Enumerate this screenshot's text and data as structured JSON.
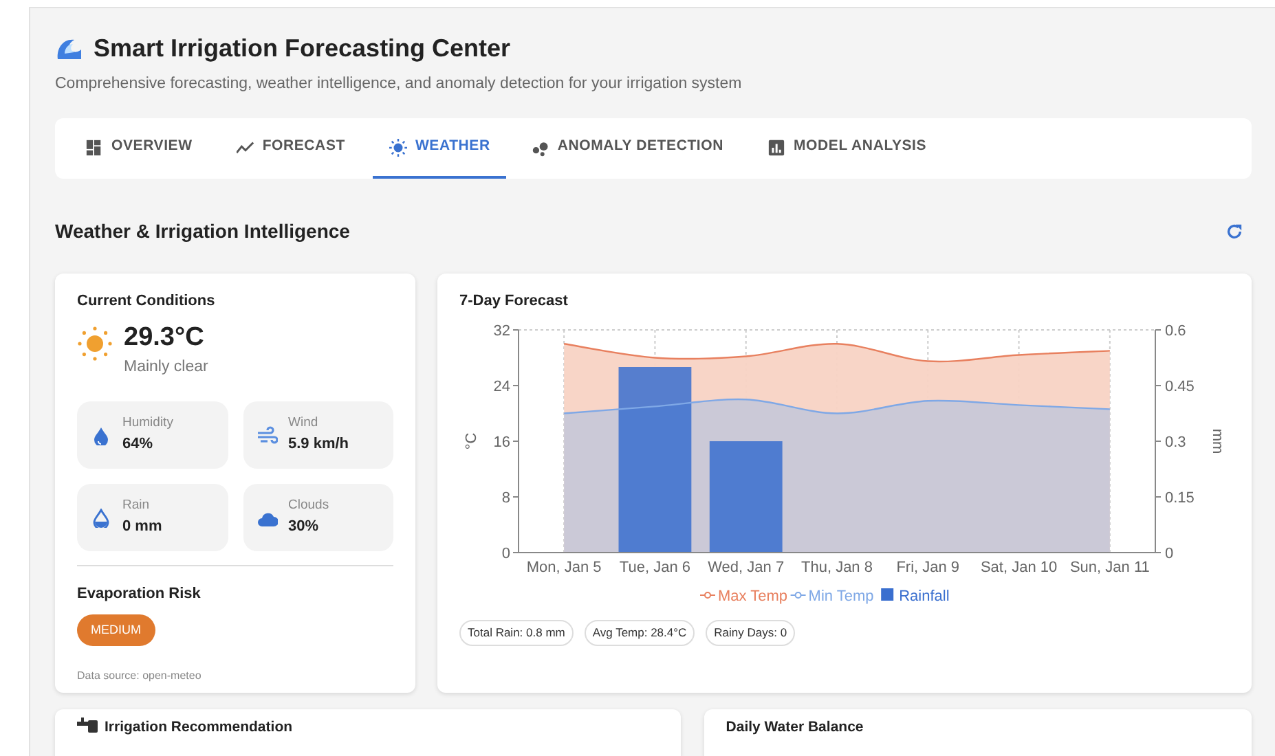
{
  "header": {
    "title": "Smart Irrigation Forecasting Center",
    "subtitle": "Comprehensive forecasting, weather intelligence, and anomaly detection for your irrigation system"
  },
  "tabs": [
    {
      "label": "OVERVIEW",
      "selected": false
    },
    {
      "label": "FORECAST",
      "selected": false
    },
    {
      "label": "WEATHER",
      "selected": true
    },
    {
      "label": "ANOMALY DETECTION",
      "selected": false
    },
    {
      "label": "MODEL ANALYSIS",
      "selected": false
    }
  ],
  "section": {
    "title": "Weather & Irrigation Intelligence"
  },
  "current": {
    "title": "Current Conditions",
    "temperature": "29.3°C",
    "condition": "Mainly clear",
    "metrics": [
      {
        "label": "Humidity",
        "value": "64%"
      },
      {
        "label": "Wind",
        "value": "5.9 km/h"
      },
      {
        "label": "Rain",
        "value": "0 mm"
      },
      {
        "label": "Clouds",
        "value": "30%"
      }
    ],
    "risk_label": "Evaporation Risk",
    "risk": "MEDIUM",
    "source": "Data source: open-meteo"
  },
  "forecast": {
    "title": "7-Day Forecast",
    "chart_data": {
      "type": "area",
      "grid": true,
      "legend": true,
      "categories": [
        "Mon, Jan 5",
        "Tue, Jan 6",
        "Wed, Jan 7",
        "Thu, Jan 8",
        "Fri, Jan 9",
        "Sat, Jan 10",
        "Sun, Jan 11"
      ],
      "ylabel": "°C",
      "y2label": "mm",
      "ylim": [
        0,
        32
      ],
      "yticks": [
        0,
        8,
        16,
        24,
        32
      ],
      "y2lim": [
        0,
        0.6
      ],
      "y2ticks": [
        0,
        0.15,
        0.3,
        0.45,
        0.6
      ],
      "series": [
        {
          "name": "Max Temp",
          "color": "#e8805f",
          "values": [
            30,
            28,
            28.2,
            30,
            27.5,
            28.4,
            29
          ]
        },
        {
          "name": "Min Temp",
          "color": "#7fa8e6",
          "values": [
            20,
            21,
            22,
            20,
            21.8,
            21.2,
            20.6
          ]
        },
        {
          "name": "Rainfall",
          "color": "#3a6fcf",
          "type": "bar",
          "axis": "y2",
          "values": [
            0,
            0.5,
            0.3,
            0,
            0,
            0,
            0
          ]
        }
      ]
    },
    "stats": [
      "Total Rain: 0.8 mm",
      "Avg Temp: 28.4°C",
      "Rainy Days: 0"
    ]
  },
  "bottom_cards": [
    {
      "title": "Irrigation Recommendation"
    },
    {
      "title": "Daily Water Balance"
    }
  ]
}
